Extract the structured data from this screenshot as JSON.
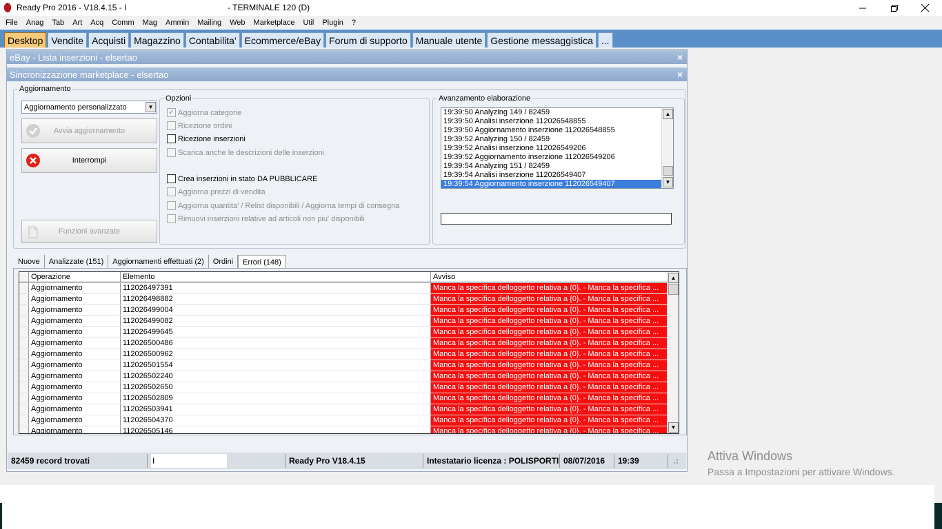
{
  "window": {
    "title": "Ready Pro 2016 - V18.4.15 - I",
    "terminal": "- TERMINALE 120 (D)"
  },
  "menu": [
    "File",
    "Anag",
    "Tab",
    "Art",
    "Acq",
    "Comm",
    "Mag",
    "Ammin",
    "Mailing",
    "Web",
    "Marketplace",
    "Util",
    "Plugin",
    "?"
  ],
  "top_tabs": [
    {
      "label": "Desktop",
      "active": true
    },
    {
      "label": "Vendite"
    },
    {
      "label": "Acquisti"
    },
    {
      "label": "Magazzino"
    },
    {
      "label": "Contabilita'"
    },
    {
      "label": "Ecommerce/eBay"
    },
    {
      "label": "Forum di supporto"
    },
    {
      "label": "Manuale utente"
    },
    {
      "label": "Gestione messaggistica"
    },
    {
      "label": "..."
    }
  ],
  "outer_window": {
    "title": "eBay - Lista inserzioni - elsertao",
    "close": "×"
  },
  "inner_window": {
    "title": "Sincronizzazione marketplace - elsertao",
    "close": "×"
  },
  "aggiornamento": {
    "legend": "Aggiornamento",
    "combo_value": "Aggiornamento personalizzato",
    "start_button": "Avvia aggiornamento",
    "stop_button": "Interrompi",
    "advanced_button": "Funzioni avanzate"
  },
  "opzioni": {
    "legend": "Opzioni",
    "items": [
      {
        "label": "Aggiorna categorie",
        "checked": true,
        "enabled": false
      },
      {
        "label": "Ricezione ordini",
        "checked": false,
        "enabled": false
      },
      {
        "label": "Ricezione inserzioni",
        "checked": false,
        "enabled": true
      },
      {
        "label": "Scarica anche le descrizioni delle inserzioni",
        "checked": false,
        "enabled": false
      },
      {
        "label": "Crea inserzioni in stato DA PUBBLICARE",
        "checked": false,
        "enabled": true
      },
      {
        "label": "Aggiorna prezzi di vendita",
        "checked": false,
        "enabled": false
      },
      {
        "label": "Aggiorna quantita' / Relist disponibili / Aggiorna tempi di consegna",
        "checked": false,
        "enabled": false
      },
      {
        "label": "Rimuovi inserzioni relative ad articoli non piu' disponibili",
        "checked": false,
        "enabled": false
      }
    ]
  },
  "avanzamento": {
    "legend": "Avanzamento elaborazione",
    "log": [
      "19:39:50 Analyzing 149 / 82459",
      "19:39:50 Analisi inserzione 112026548855",
      "19:39:50 Aggiornamento inserzione 112026548855",
      "19:39:52 Analyzing 150 / 82459",
      "19:39:52 Analisi inserzione 112026549206",
      "19:39:52 Aggiornamento inserzione 112026549206",
      "19:39:54 Analyzing 151 / 82459",
      "19:39:54 Analisi inserzione 112026549407",
      "19:39:54 Aggiornamento inserzione 112026549407"
    ],
    "selected_index": 8
  },
  "result_tabs": [
    {
      "label": "Nuove"
    },
    {
      "label": "Analizzate (151)"
    },
    {
      "label": "Aggiornamenti effettuati (2)"
    },
    {
      "label": "Ordini"
    },
    {
      "label": "Errori (148)",
      "active": true
    }
  ],
  "grid": {
    "columns": [
      "Operazione",
      "Elemento",
      "Avviso"
    ],
    "rows": [
      [
        "Aggiornamento",
        "112026497391",
        "Manca la specifica delloggetto relativa a {0}. - Manca la specifica ..."
      ],
      [
        "Aggiornamento",
        "112026498882",
        "Manca la specifica delloggetto relativa a {0}. - Manca la specifica ..."
      ],
      [
        "Aggiornamento",
        "112026499004",
        "Manca la specifica delloggetto relativa a {0}. - Manca la specifica ..."
      ],
      [
        "Aggiornamento",
        "112026499082",
        "Manca la specifica delloggetto relativa a {0}. - Manca la specifica ..."
      ],
      [
        "Aggiornamento",
        "112026499645",
        "Manca la specifica delloggetto relativa a {0}. - Manca la specifica ..."
      ],
      [
        "Aggiornamento",
        "112026500486",
        "Manca la specifica delloggetto relativa a {0}. - Manca la specifica ..."
      ],
      [
        "Aggiornamento",
        "112026500962",
        "Manca la specifica delloggetto relativa a {0}. - Manca la specifica ..."
      ],
      [
        "Aggiornamento",
        "112026501554",
        "Manca la specifica delloggetto relativa a {0}. - Manca la specifica ..."
      ],
      [
        "Aggiornamento",
        "112026502240",
        "Manca la specifica delloggetto relativa a {0}. - Manca la specifica ..."
      ],
      [
        "Aggiornamento",
        "112026502650",
        "Manca la specifica delloggetto relativa a {0}. - Manca la specifica ..."
      ],
      [
        "Aggiornamento",
        "112026502809",
        "Manca la specifica delloggetto relativa a {0}. - Manca la specifica ..."
      ],
      [
        "Aggiornamento",
        "112026503941",
        "Manca la specifica delloggetto relativa a {0}. - Manca la specifica ..."
      ],
      [
        "Aggiornamento",
        "112026504370",
        "Manca la specifica delloggetto relativa a {0}. - Manca la specifica ..."
      ],
      [
        "Aggiornamento",
        "112026505146",
        "Manca la specifica delloggetto relativa a {0}. - Manca la specifica ..."
      ]
    ]
  },
  "status": {
    "records": "82459 record trovati",
    "search_value": "I",
    "version": "Ready Pro V18.4.15",
    "license": "Intestatario licenza : POLISPORTIV",
    "date": "08/07/2016",
    "time": "19:39"
  },
  "watermark": {
    "line1": "Attiva Windows",
    "line2": "Passa a Impostazioni per attivare Windows."
  },
  "colors": {
    "error_cell": "#f50f0f",
    "tab_bar": "#5b8fc7",
    "active_tab": "#f7c97a",
    "selection": "#3a7ddb"
  }
}
